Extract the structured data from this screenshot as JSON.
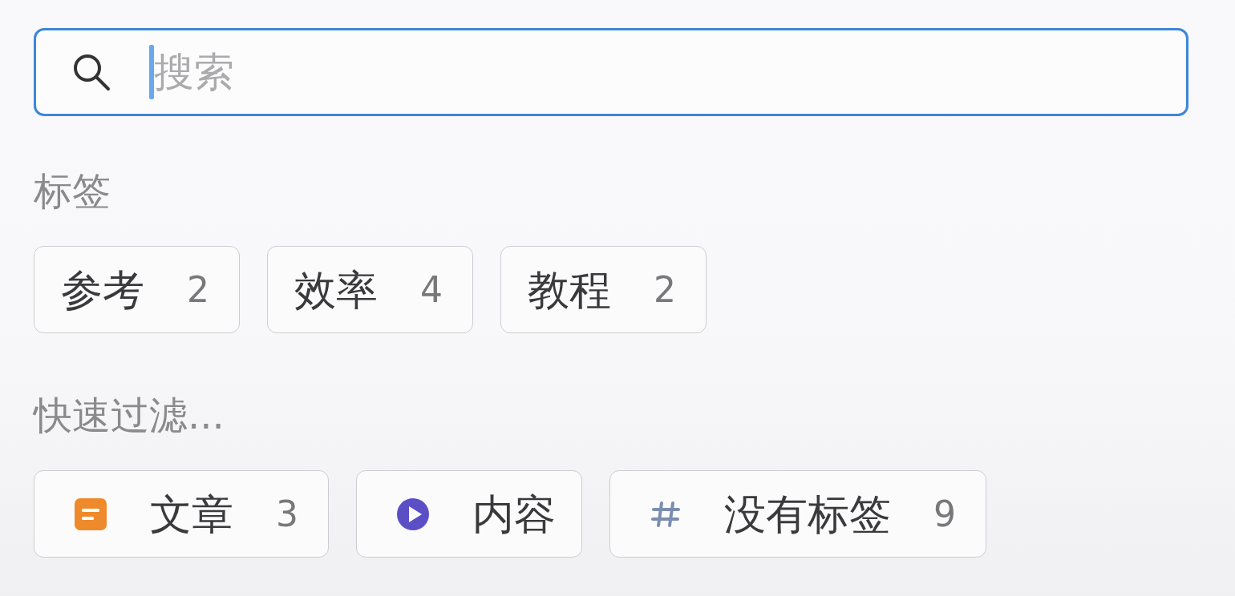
{
  "search": {
    "placeholder": "搜索",
    "focused": true
  },
  "tags": {
    "heading": "标签",
    "items": [
      {
        "label": "参考",
        "count": "2"
      },
      {
        "label": "效率",
        "count": "4"
      },
      {
        "label": "教程",
        "count": "2"
      }
    ]
  },
  "quick_filters": {
    "heading": "快速过滤...",
    "items": [
      {
        "kind": "document",
        "color": "#ef8a2c",
        "label": "文章",
        "count": "3"
      },
      {
        "kind": "play",
        "color": "#5b4fc6",
        "label": "内容"
      },
      {
        "kind": "hashtag",
        "color": "#7b8db0",
        "label": "没有标签",
        "count": "9"
      }
    ]
  }
}
